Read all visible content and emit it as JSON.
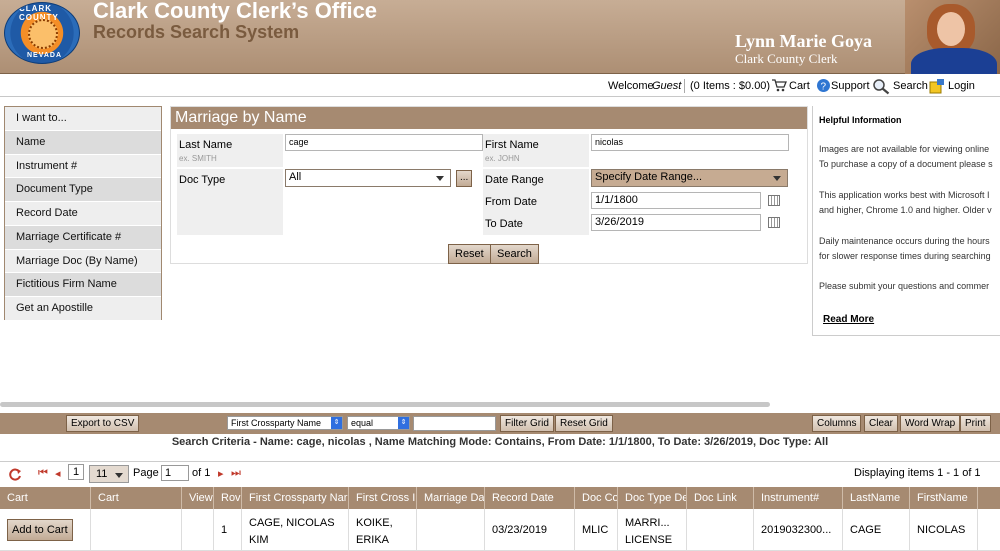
{
  "header": {
    "title": "Clark County Clerk’s Office",
    "subtitle": "Records Search System",
    "clerk_name": "Lynn Marie Goya",
    "clerk_title": "Clark County Clerk",
    "seal_text_top": "CLARK COUNTY",
    "seal_text_bottom": "NEVADA"
  },
  "topnav": {
    "welcome": "Welcome",
    "user": "Guest",
    "cart_summary": "(0 Items : $0.00)",
    "cart": "Cart",
    "support": "Support",
    "search": "Search",
    "login": "Login"
  },
  "sidebar": {
    "items": [
      {
        "label": "I want to..."
      },
      {
        "label": "Name"
      },
      {
        "label": "Instrument #"
      },
      {
        "label": "Document Type"
      },
      {
        "label": "Record Date"
      },
      {
        "label": "Marriage Certificate #"
      },
      {
        "label": "Marriage Doc (By Name)"
      },
      {
        "label": "Fictitious Firm Name"
      },
      {
        "label": "Get an Apostille"
      }
    ]
  },
  "form": {
    "title": "Marriage by Name",
    "last_name_label": "Last Name",
    "last_name_example": "ex. SMITH",
    "last_name_value": "cage",
    "first_name_label": "First Name",
    "first_name_example": "ex. JOHN",
    "first_name_value": "nicolas",
    "doc_type_label": "Doc Type",
    "doc_type_value": "All",
    "doc_type_more": "...",
    "date_range_label": "Date Range",
    "date_range_value": "Specify Date Range...",
    "from_date_label": "From Date",
    "from_date_value": "1/1/1800",
    "to_date_label": "To Date",
    "to_date_value": "3/26/2019",
    "reset": "Reset",
    "search": "Search"
  },
  "info": {
    "title": "Helpful Information",
    "lines": [
      "Images are not available for viewing online",
      "To purchase a copy of a document please s",
      "This application works best with Microsoft I",
      "and higher, Chrome 1.0 and higher. Older v",
      "Daily maintenance occurs during the hours",
      "for slower response times during searching",
      "Please submit your questions and commer"
    ],
    "read_more": "Read More"
  },
  "grid_toolbar": {
    "export": "Export to CSV",
    "field_select": "First Crossparty Name",
    "operator_select": "equal",
    "filter_value": "",
    "filter": "Filter Grid",
    "reset": "Reset Grid",
    "columns": "Columns",
    "clear": "Clear",
    "word_wrap": "Word Wrap",
    "print": "Print"
  },
  "criteria": "Search Criteria - Name: cage, nicolas , Name Matching Mode: Contains, From Date: 1/1/1800, To Date: 3/26/2019, Doc Type: All",
  "pager": {
    "first_page_box": "1",
    "page_size": "11",
    "page_label": "Page",
    "page_value": "1",
    "of": "of 1",
    "display": "Displaying items 1 - 1 of 1"
  },
  "table": {
    "columns": [
      "Cart",
      "Cart",
      "View",
      "Rov",
      "First Crossparty Nar",
      "First Cross I",
      "Marriage Da",
      "Record Date",
      "Doc Co",
      "Doc Type De",
      "Doc Link",
      "Instrument#",
      "LastName",
      "FirstName"
    ],
    "row": {
      "cart_button": "Add to Cart",
      "cart": "",
      "view": "",
      "row": "1",
      "first_crossparty_name_l1": "CAGE, NICOLAS",
      "first_crossparty_name_l2": "KIM",
      "first_cross_l1": "KOIKE,",
      "first_cross_l2": "ERIKA",
      "marriage_date": "",
      "record_date": "03/23/2019",
      "doc_code": "MLIC",
      "doc_type_l1": "MARRI...",
      "doc_type_l2": "LICENSE",
      "doc_link": "",
      "instrument": "2019032300...",
      "last_name": "CAGE",
      "first_name": "NICOLAS"
    }
  }
}
